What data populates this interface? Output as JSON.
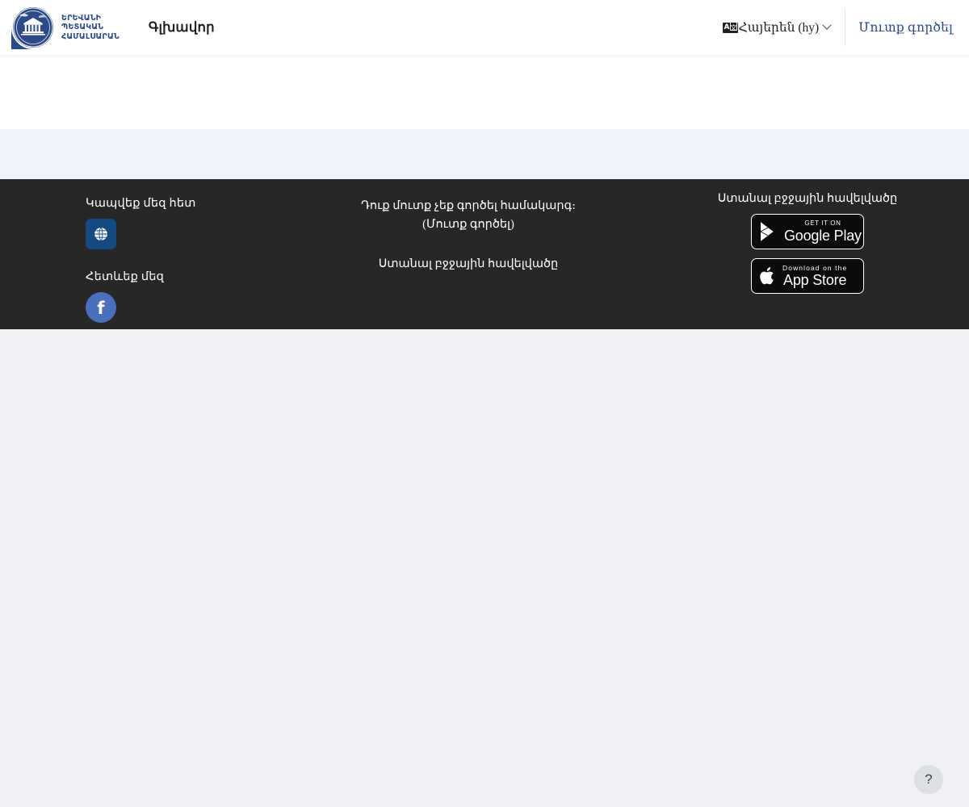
{
  "navbar": {
    "brand": {
      "logo_icon": "yerevan-state-university-emblem",
      "logo_text": "ԵՐԵՎԱՆԻ\nՊԵՏԱԿԱՆ\nՀԱՄԱԼՍԱՐԱՆ",
      "brand_color": "#2b4a86"
    },
    "home_label": "Գլխավոր",
    "language": {
      "icon": "translate-icon",
      "label": "Հայերեն (hy)",
      "chevron_icon": "chevron-down-icon"
    },
    "login_label": "Մուտք գործել",
    "login_color": "#2b4a86"
  },
  "footer": {
    "background_color": "#272727",
    "contact": {
      "heading": "Կապվեք մեզ հետ",
      "website_icon": "globe-icon",
      "website_icon_color": "#144a80"
    },
    "follow": {
      "heading": "Հետևեք մեզ",
      "facebook_icon": "facebook-icon",
      "facebook_icon_color": "#4a6fbd"
    },
    "status": {
      "text": "Դուք մուտք չեք գործել համակարգ։ (Մուտք գործել)",
      "mobile_app_link": "Ստանալ բջջային հավելվածը"
    },
    "mobile": {
      "heading": "Ստանալ բջջային հավելվածը",
      "google_play": {
        "icon": "google-play-icon",
        "top_line": "GET IT ON",
        "main_line": "Google Play"
      },
      "app_store": {
        "icon": "apple-icon",
        "top_line": "Download on the",
        "main_line": "App Store"
      }
    }
  },
  "help": {
    "label": "?",
    "icon": "question-mark-icon"
  }
}
